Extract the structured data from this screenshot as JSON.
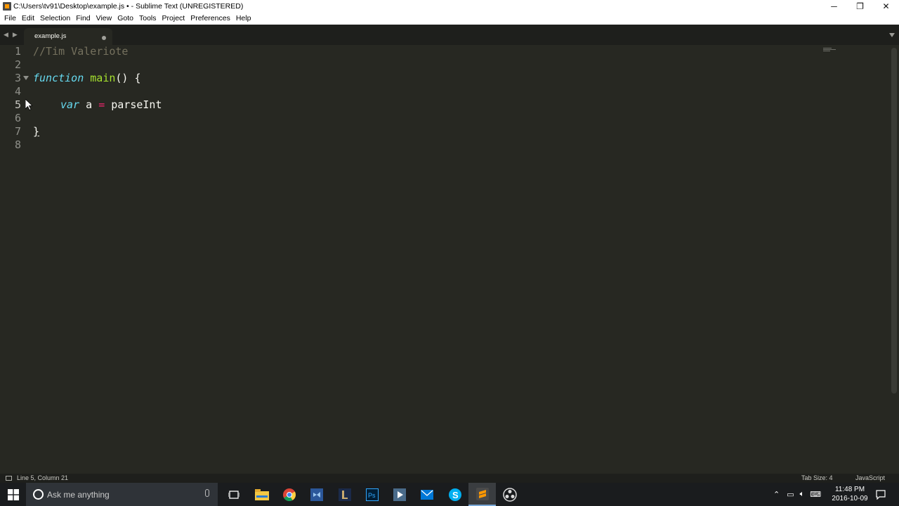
{
  "window": {
    "title": "C:\\Users\\tv91\\Desktop\\example.js • - Sublime Text (UNREGISTERED)",
    "controls": {
      "minimize": "─",
      "maximize": "❐",
      "close": "✕"
    }
  },
  "menu": [
    "File",
    "Edit",
    "Selection",
    "Find",
    "View",
    "Goto",
    "Tools",
    "Project",
    "Preferences",
    "Help"
  ],
  "tabs": [
    {
      "label": "example.js",
      "modified": true
    }
  ],
  "editor": {
    "lines": [
      {
        "n": "1",
        "comment": "//Tim Valeriote"
      },
      {
        "n": "2"
      },
      {
        "n": "3",
        "kw": "function",
        "name": "main",
        "rest": "() {"
      },
      {
        "n": "4"
      },
      {
        "n": "5",
        "kw": "var",
        "ident": "a",
        "op": "=",
        "call": "parseInt"
      },
      {
        "n": "6"
      },
      {
        "n": "7",
        "close": "}"
      },
      {
        "n": "8"
      }
    ]
  },
  "status": {
    "position": "Line 5, Column 21",
    "tab_size": "Tab Size: 4",
    "syntax": "JavaScript"
  },
  "taskbar": {
    "search_placeholder": "Ask me anything",
    "apps": [
      "task-view-icon",
      "file-explorer-icon",
      "chrome-icon",
      "visual-studio-icon",
      "lol-icon",
      "photoshop-icon",
      "media-player-icon",
      "mail-icon",
      "skype-icon",
      "sublime-text-icon",
      "obs-icon"
    ],
    "time": "11:48 PM",
    "date": "2016-10-09"
  },
  "colors": {
    "editor_bg": "#272822",
    "comment": "#75715e",
    "storage": "#66d9ef",
    "function_name": "#a6e22e",
    "operator": "#f92672"
  }
}
